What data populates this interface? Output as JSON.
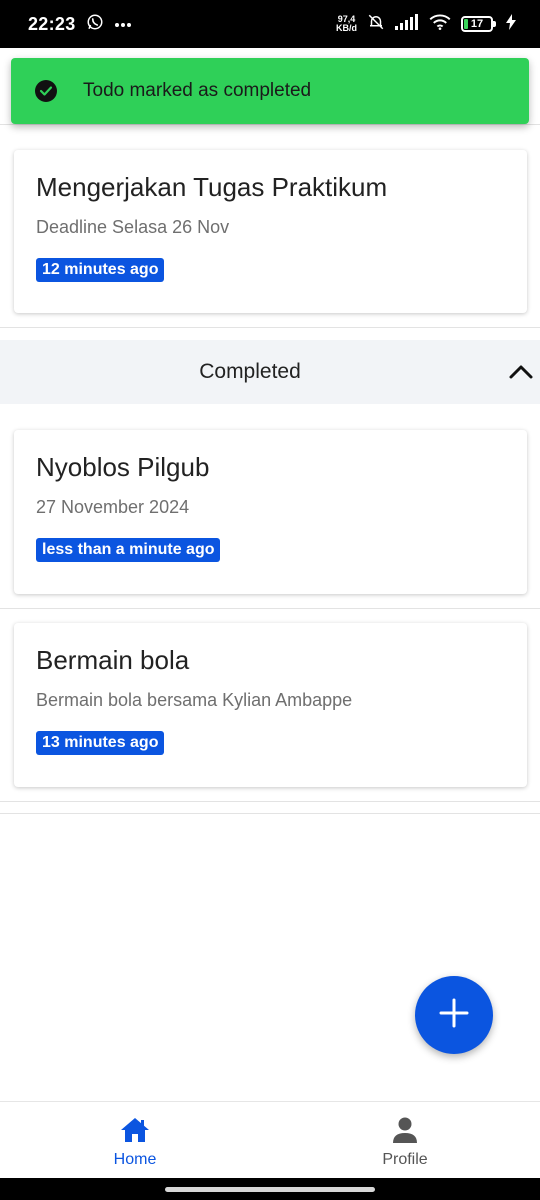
{
  "status_bar": {
    "time": "22:23",
    "net_speed_value": "97,4",
    "net_speed_unit": "KB/d",
    "battery_level": "17"
  },
  "toast": {
    "message": "Todo marked as completed",
    "color": "#2fd058"
  },
  "todos": [
    {
      "title": "Mengerjakan Tugas Praktikum",
      "description": "Deadline Selasa 26 Nov",
      "time_ago": "12 minutes ago"
    }
  ],
  "completed_section": {
    "title": "Completed",
    "items": [
      {
        "title": "Nyoblos Pilgub",
        "description": "27 November 2024",
        "time_ago": "less than a minute ago"
      },
      {
        "title": "Bermain bola",
        "description": "Bermain bola bersama Kylian Ambappe",
        "time_ago": "13 minutes ago"
      }
    ]
  },
  "bottom_nav": {
    "items": [
      {
        "label": "Home",
        "icon": "home-icon",
        "active": true
      },
      {
        "label": "Profile",
        "icon": "person-icon",
        "active": false
      }
    ]
  },
  "colors": {
    "accent": "#0b55e0",
    "success": "#2fd058"
  }
}
